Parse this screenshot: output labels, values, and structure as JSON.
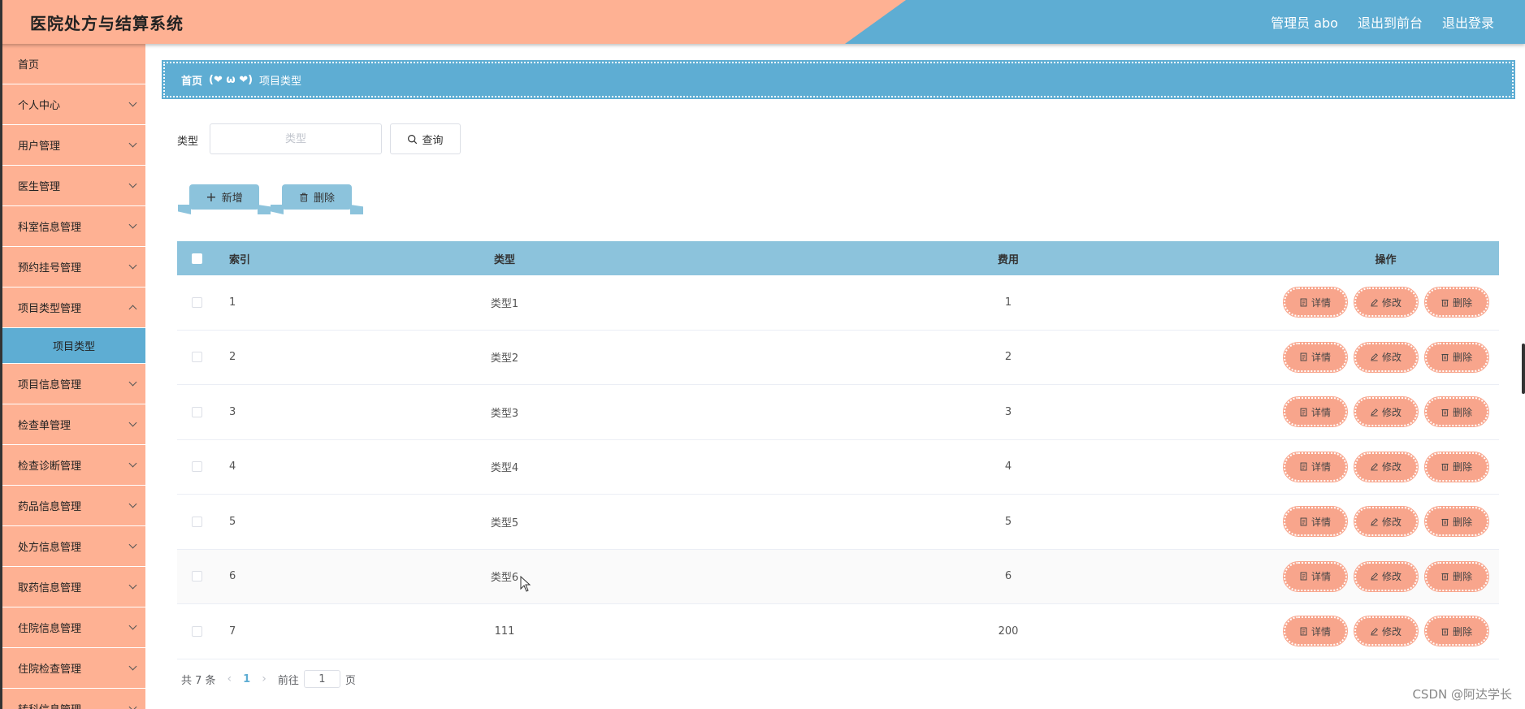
{
  "header": {
    "title": "医院处方与结算系统",
    "admin": "管理员 abo",
    "to_front": "退出到前台",
    "logout": "退出登录"
  },
  "sidebar": {
    "items": [
      {
        "label": "首页"
      },
      {
        "label": "个人中心"
      },
      {
        "label": "用户管理"
      },
      {
        "label": "医生管理"
      },
      {
        "label": "科室信息管理"
      },
      {
        "label": "预约挂号管理"
      },
      {
        "label": "项目类型管理"
      },
      {
        "label": "项目信息管理"
      },
      {
        "label": "检查单管理"
      },
      {
        "label": "检查诊断管理"
      },
      {
        "label": "药品信息管理"
      },
      {
        "label": "处方信息管理"
      },
      {
        "label": "取药信息管理"
      },
      {
        "label": "住院信息管理"
      },
      {
        "label": "住院检查管理"
      },
      {
        "label": "转科信息管理"
      }
    ],
    "active_sub": "项目类型"
  },
  "breadcrumb": {
    "home": "首页",
    "separator": "(❤ ω ❤)",
    "current": "项目类型"
  },
  "search": {
    "label": "类型",
    "placeholder": "类型",
    "query_label": "查询"
  },
  "actions": {
    "add_label": "新增",
    "delete_label": "删除"
  },
  "table": {
    "headers": {
      "index": "索引",
      "type": "类型",
      "fee": "费用",
      "ops": "操作"
    },
    "op_labels": {
      "detail": "详情",
      "edit": "修改",
      "delete": "删除"
    },
    "rows": [
      {
        "index": "1",
        "type": "类型1",
        "fee": "1"
      },
      {
        "index": "2",
        "type": "类型2",
        "fee": "2"
      },
      {
        "index": "3",
        "type": "类型3",
        "fee": "3"
      },
      {
        "index": "4",
        "type": "类型4",
        "fee": "4"
      },
      {
        "index": "5",
        "type": "类型5",
        "fee": "5"
      },
      {
        "index": "6",
        "type": "类型6",
        "fee": "6"
      },
      {
        "index": "7",
        "type": "111",
        "fee": "200"
      }
    ]
  },
  "pagination": {
    "total": "共 7 条",
    "current_page": "1",
    "goto_label": "前往",
    "goto_value": "1",
    "page_suffix": "页"
  },
  "watermark": "CSDN @阿达学长",
  "colors": {
    "accent_peach": "#feb193",
    "accent_blue": "#5eadd3",
    "table_header": "#8cc3dc",
    "op_button": "#f8a58c"
  }
}
